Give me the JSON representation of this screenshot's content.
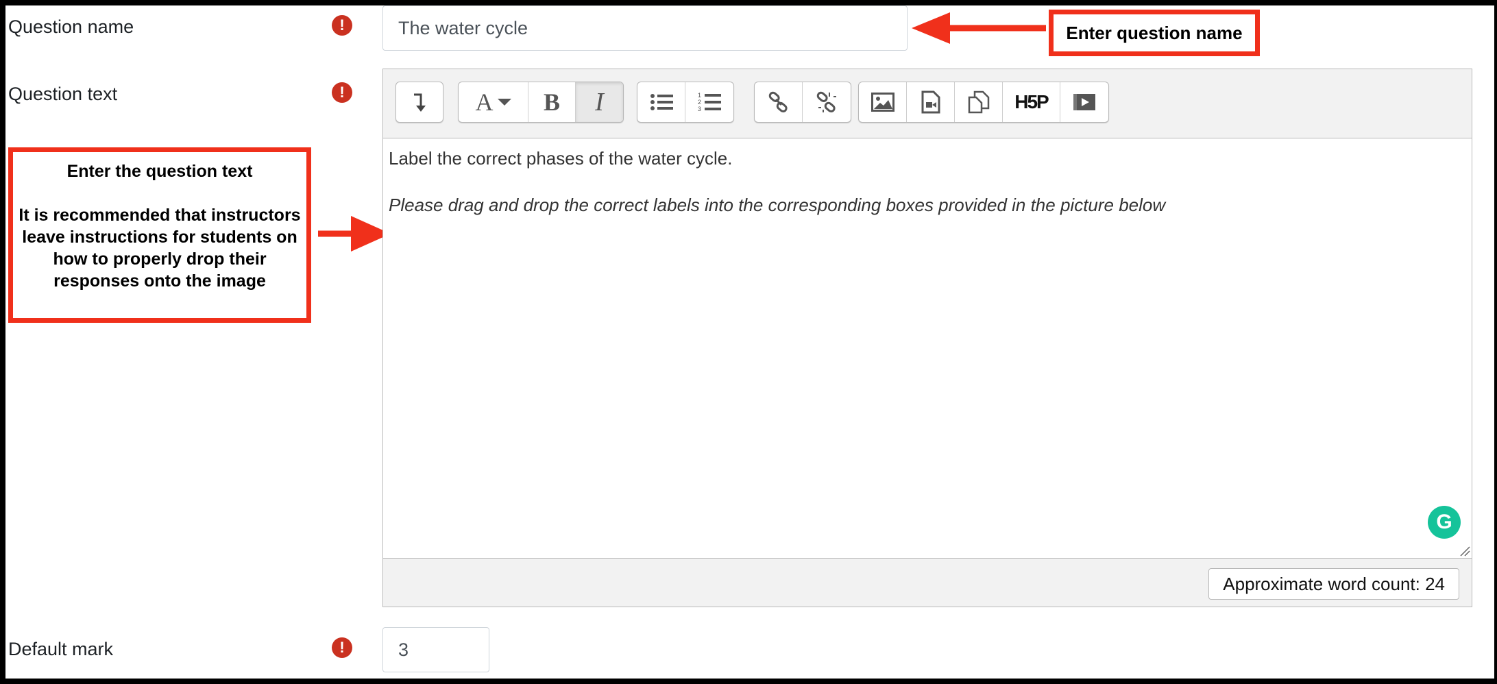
{
  "form": {
    "question_name_label": "Question name",
    "question_name_value": "The water cycle",
    "question_text_label": "Question text",
    "default_mark_label": "Default mark",
    "default_mark_value": "3",
    "required_glyph": "!"
  },
  "editor": {
    "toolbar_icons": [
      "collapse-icon",
      "font-style-icon",
      "bold-icon",
      "italic-icon",
      "unordered-list-icon",
      "ordered-list-icon",
      "link-icon",
      "unlink-icon",
      "image-icon",
      "media-icon",
      "manage-files-icon",
      "h5p-icon",
      "video-icon"
    ],
    "bold_glyph": "B",
    "italic_glyph": "I",
    "font_glyph": "A",
    "h5p_label": "H5P",
    "content_line1": "Label the correct phases of the water cycle.",
    "content_line2": "Please drag and drop the correct labels into the corresponding boxes provided in the picture below",
    "word_count": "Approximate word count: 24",
    "grammarly_glyph": "G"
  },
  "callouts": {
    "question_name": "Enter question name",
    "question_text_title": "Enter the question text",
    "question_text_body": "It is recommended that instructors leave instructions for students on how to properly drop their responses onto the image"
  },
  "colors": {
    "callout_red": "#f0301b",
    "required_red": "#ca3120",
    "grammarly_green": "#15c39a"
  }
}
